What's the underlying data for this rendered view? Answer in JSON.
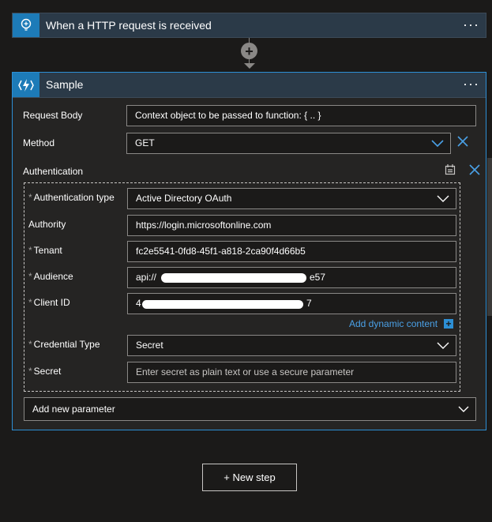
{
  "trigger": {
    "title": "When a HTTP request is received",
    "menu": "···",
    "icon": "http-request-icon"
  },
  "connector": {
    "add_label": "+"
  },
  "action": {
    "title": "Sample",
    "menu": "···",
    "icon": "azure-function-icon",
    "request_body": {
      "label": "Request Body",
      "value": "Context object to be passed to function: { .. }"
    },
    "method": {
      "label": "Method",
      "value": "GET"
    },
    "authentication": {
      "label": "Authentication",
      "type": {
        "label": "Authentication type",
        "value": "Active Directory OAuth"
      },
      "authority": {
        "label": "Authority",
        "value": "https://login.microsoftonline.com"
      },
      "tenant": {
        "label": "Tenant",
        "value": "fc2e5541-0fd8-45f1-a818-2ca90f4d66b5"
      },
      "audience": {
        "label": "Audience",
        "value_start": "api://",
        "value_end": "e57"
      },
      "client_id": {
        "label": "Client ID",
        "value_start": "4",
        "value_end": "7"
      },
      "dynamic_content": "Add dynamic content",
      "credential_type": {
        "label": "Credential Type",
        "value": "Secret"
      },
      "secret": {
        "label": "Secret",
        "placeholder": "Enter secret as plain text or use a secure parameter"
      }
    },
    "add_param": "Add new parameter"
  },
  "new_step": "+ New step",
  "colors": {
    "background": "#1b1a19",
    "header": "#2b3a48",
    "icon_tile": "#1d7bb8",
    "accent": "#2d8fd5",
    "link": "#4aa0e6"
  }
}
